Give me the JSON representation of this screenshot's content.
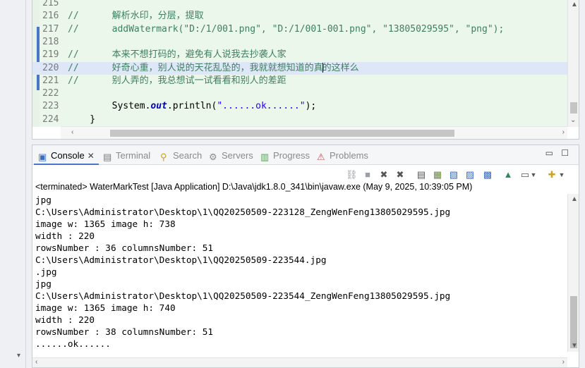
{
  "editor": {
    "lines": [
      {
        "num": "215",
        "segments": []
      },
      {
        "num": "216",
        "segments": [
          {
            "cls": "c-comment",
            "text": "//      解析水印，分层，提取"
          }
        ]
      },
      {
        "num": "217",
        "segments": [
          {
            "cls": "c-comment",
            "text": "//      addWatermark(\"D:/1/001.png\", \"D:/1/001-001.png\", \"13805029595\", \"png\");"
          }
        ]
      },
      {
        "num": "218",
        "segments": []
      },
      {
        "num": "219",
        "segments": [
          {
            "cls": "c-comment",
            "text": "//      本来不想打码的，避免有人说我去抄袭人家"
          }
        ]
      },
      {
        "num": "220",
        "current": true,
        "segments": [
          {
            "cls": "c-comment",
            "text": "//      好奇心重，别人说的天花乱坠的，我就就想知道的真"
          },
          {
            "cls": "caret",
            "text": ""
          },
          {
            "cls": "c-comment",
            "text": "的这样么"
          }
        ]
      },
      {
        "num": "221",
        "segments": [
          {
            "cls": "c-comment",
            "text": "//      别人弄的，我总想试一试看看和别人的差距"
          }
        ]
      },
      {
        "num": "222",
        "segments": []
      },
      {
        "num": "223",
        "segments": [
          {
            "cls": "c-plain",
            "text": "        System."
          },
          {
            "cls": "c-field",
            "text": "out"
          },
          {
            "cls": "c-plain",
            "text": ".println("
          },
          {
            "cls": "c-str",
            "text": "\"......ok......\""
          },
          {
            "cls": "c-plain",
            "text": ");"
          }
        ]
      },
      {
        "num": "224",
        "segments": [
          {
            "cls": "c-plain",
            "text": "    }"
          }
        ]
      }
    ]
  },
  "tabs": [
    {
      "label": "Console",
      "icon": "console-icon",
      "active": true
    },
    {
      "label": "Terminal",
      "icon": "terminal-icon"
    },
    {
      "label": "Search",
      "icon": "search-icon"
    },
    {
      "label": "Servers",
      "icon": "servers-icon"
    },
    {
      "label": "Progress",
      "icon": "progress-icon"
    },
    {
      "label": "Problems",
      "icon": "problems-icon"
    }
  ],
  "tab_close_glyph": "✕",
  "window": {
    "minimize": "▭",
    "maximize": "☐"
  },
  "toolbar_icons": [
    "link-icon",
    "terminate-icon",
    "remove-launch-icon",
    "remove-all-icon",
    "scroll-lock-icon",
    "show-on-output-icon",
    "pin-icon",
    "word-wrap-icon",
    "clear-icon",
    "pin-console-icon",
    "display-console-icon",
    "open-console-icon"
  ],
  "console": {
    "status": "<terminated> WaterMarkTest [Java Application] D:\\Java\\jdk1.8.0_341\\bin\\javaw.exe  (May 9, 2025, 10:39:05 PM)",
    "lines": [
      "jpg",
      "C:\\Users\\Administrator\\Desktop\\1\\QQ20250509-223128_ZengWenFeng13805029595.jpg",
      "image w: 1365 image h: 738",
      "width : 220",
      "rowsNumber : 36 columnsNumber: 51",
      "C:\\Users\\Administrator\\Desktop\\1\\QQ20250509-223544.jpg",
      ".jpg",
      "jpg",
      "C:\\Users\\Administrator\\Desktop\\1\\QQ20250509-223544_ZengWenFeng13805029595.jpg",
      "image w: 1365 image h: 740",
      "width : 220",
      "rowsNumber : 38 columnsNumber: 51",
      "......ok......"
    ]
  },
  "colors": {
    "accent": "#4a76c9",
    "editor_bg": "#eaf7ea",
    "current_line": "#dde7f7",
    "comment": "#3f7f5f",
    "string": "#2a00ff",
    "field": "#0000c0"
  }
}
